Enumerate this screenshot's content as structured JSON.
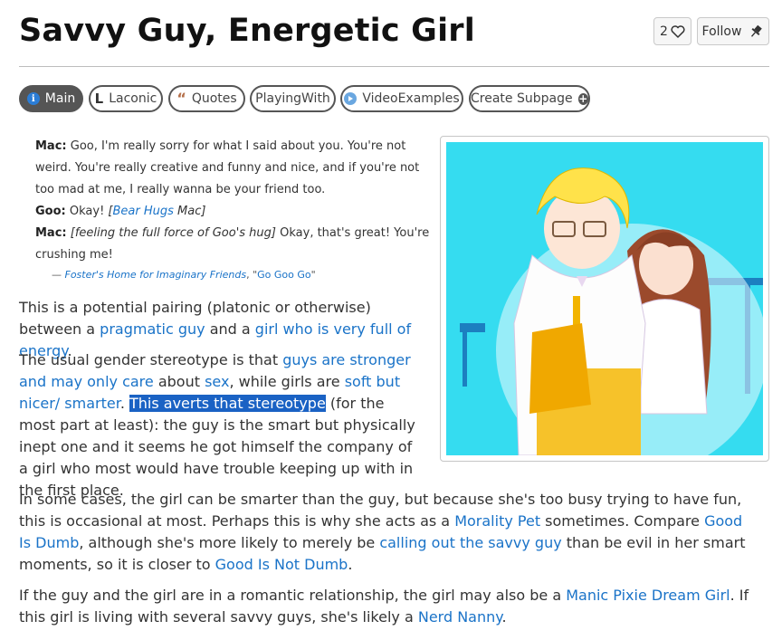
{
  "page": {
    "title": "Savvy Guy, Energetic Girl",
    "fav_count": "2",
    "follow_label": "Follow"
  },
  "tabs": [
    {
      "label": "Main",
      "icon": "info-icon",
      "active": true
    },
    {
      "label": "Laconic",
      "icon": "laconic-icon"
    },
    {
      "label": "Quotes",
      "icon": "quote-icon"
    },
    {
      "label": "PlayingWith"
    },
    {
      "label": "VideoExamples",
      "icon": "play-icon"
    },
    {
      "label": "Create Subpage",
      "icon": "plus-icon"
    }
  ],
  "quote": {
    "l1_speaker": "Mac:",
    "l1_text": "Goo, I'm really sorry for what I said about you. You're not weird. You're really creative and funny and nice, and if you're not too mad at me, I really wanna be your friend too.",
    "l2_speaker": "Goo:",
    "l2_text": "Okay!",
    "l2_action_link": "Bear Hugs",
    "l2_action_rest": "Mac",
    "l3_speaker": "Mac:",
    "l3_action": "[feeling the full force of Goo's hug]",
    "l3_text": "Okay, that's great! You're crushing me!",
    "cite_dash": "—",
    "cite_work": "Foster's Home for Imaginary Friends",
    "cite_sep": ", \"",
    "cite_episode": "Go Goo Go",
    "cite_end": "\""
  },
  "body": {
    "p1": {
      "t1": "This is a potential pairing (platonic or otherwise) between a ",
      "l1": "pragmatic guy",
      "t2": " and a ",
      "l2": "girl who is very full of energy",
      "t3": "."
    },
    "p2": {
      "t1": "The usual gender stereotype is that ",
      "l1": "guys are stronger and may only care",
      "t2": " about ",
      "l2": "sex",
      "t3": ", while girls are ",
      "l3": "soft but nicer/ smarter",
      "t4": ". ",
      "sel": "This averts that stereotype",
      "t5": " (for the most part at least): the guy is the smart but physically inept one and it seems he got himself the company of a girl who most would have trouble keeping up with in the first place."
    },
    "p3": {
      "t1": "In some cases, the girl can be smarter than the guy, but because she's too busy trying to have fun, this is occasional at most. Perhaps this is why she acts as a ",
      "l1": "Morality Pet",
      "t2": " sometimes. Compare ",
      "l2": "Good Is Dumb",
      "t3": ", although she's more likely to merely be ",
      "l3": "calling out the savvy guy",
      "t4": " than be evil in her smart moments, so it is closer to ",
      "l4": "Good Is Not Dumb",
      "t5": "."
    },
    "p4": {
      "t1": "If the guy and the girl are in a romantic relationship, the girl may also be a ",
      "l1": "Manic Pixie Dream Girl",
      "t2": ". If this girl is living with several savvy guys, she's likely a ",
      "l2": "Nerd Nanny",
      "t3": "."
    }
  },
  "colors": {
    "link": "#1a73c8",
    "selection": "#1a62c4",
    "image_bg": "#35dcf0"
  }
}
